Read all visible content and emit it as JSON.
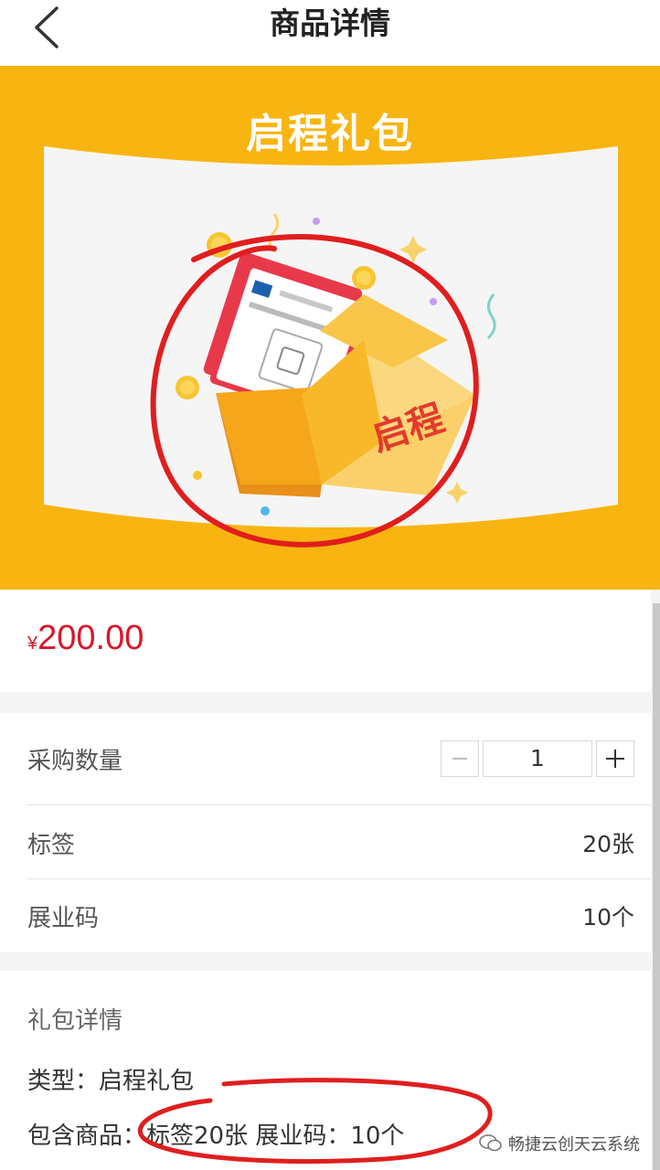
{
  "header": {
    "title": "商品详情",
    "back_icon": "chevron-left-icon"
  },
  "banner": {
    "title": "启程礼包",
    "box_label": "启程",
    "background_color": "#f8b410"
  },
  "price": {
    "currency": "¥",
    "amount": "200.00",
    "color": "#d8182a"
  },
  "options": {
    "quantity_label": "采购数量",
    "quantity_value": "1",
    "minus_icon": "minus-icon",
    "plus_icon": "plus-icon",
    "tag_label": "标签",
    "tag_value": "20张",
    "code_label": "展业码",
    "code_value": "10个"
  },
  "details": {
    "title": "礼包详情",
    "type_line": "类型：启程礼包",
    "contents_line": "包含商品：标签20张 展业码：10个"
  },
  "watermark": {
    "text": "畅捷云创天云系统",
    "icon": "wechat-icon"
  }
}
